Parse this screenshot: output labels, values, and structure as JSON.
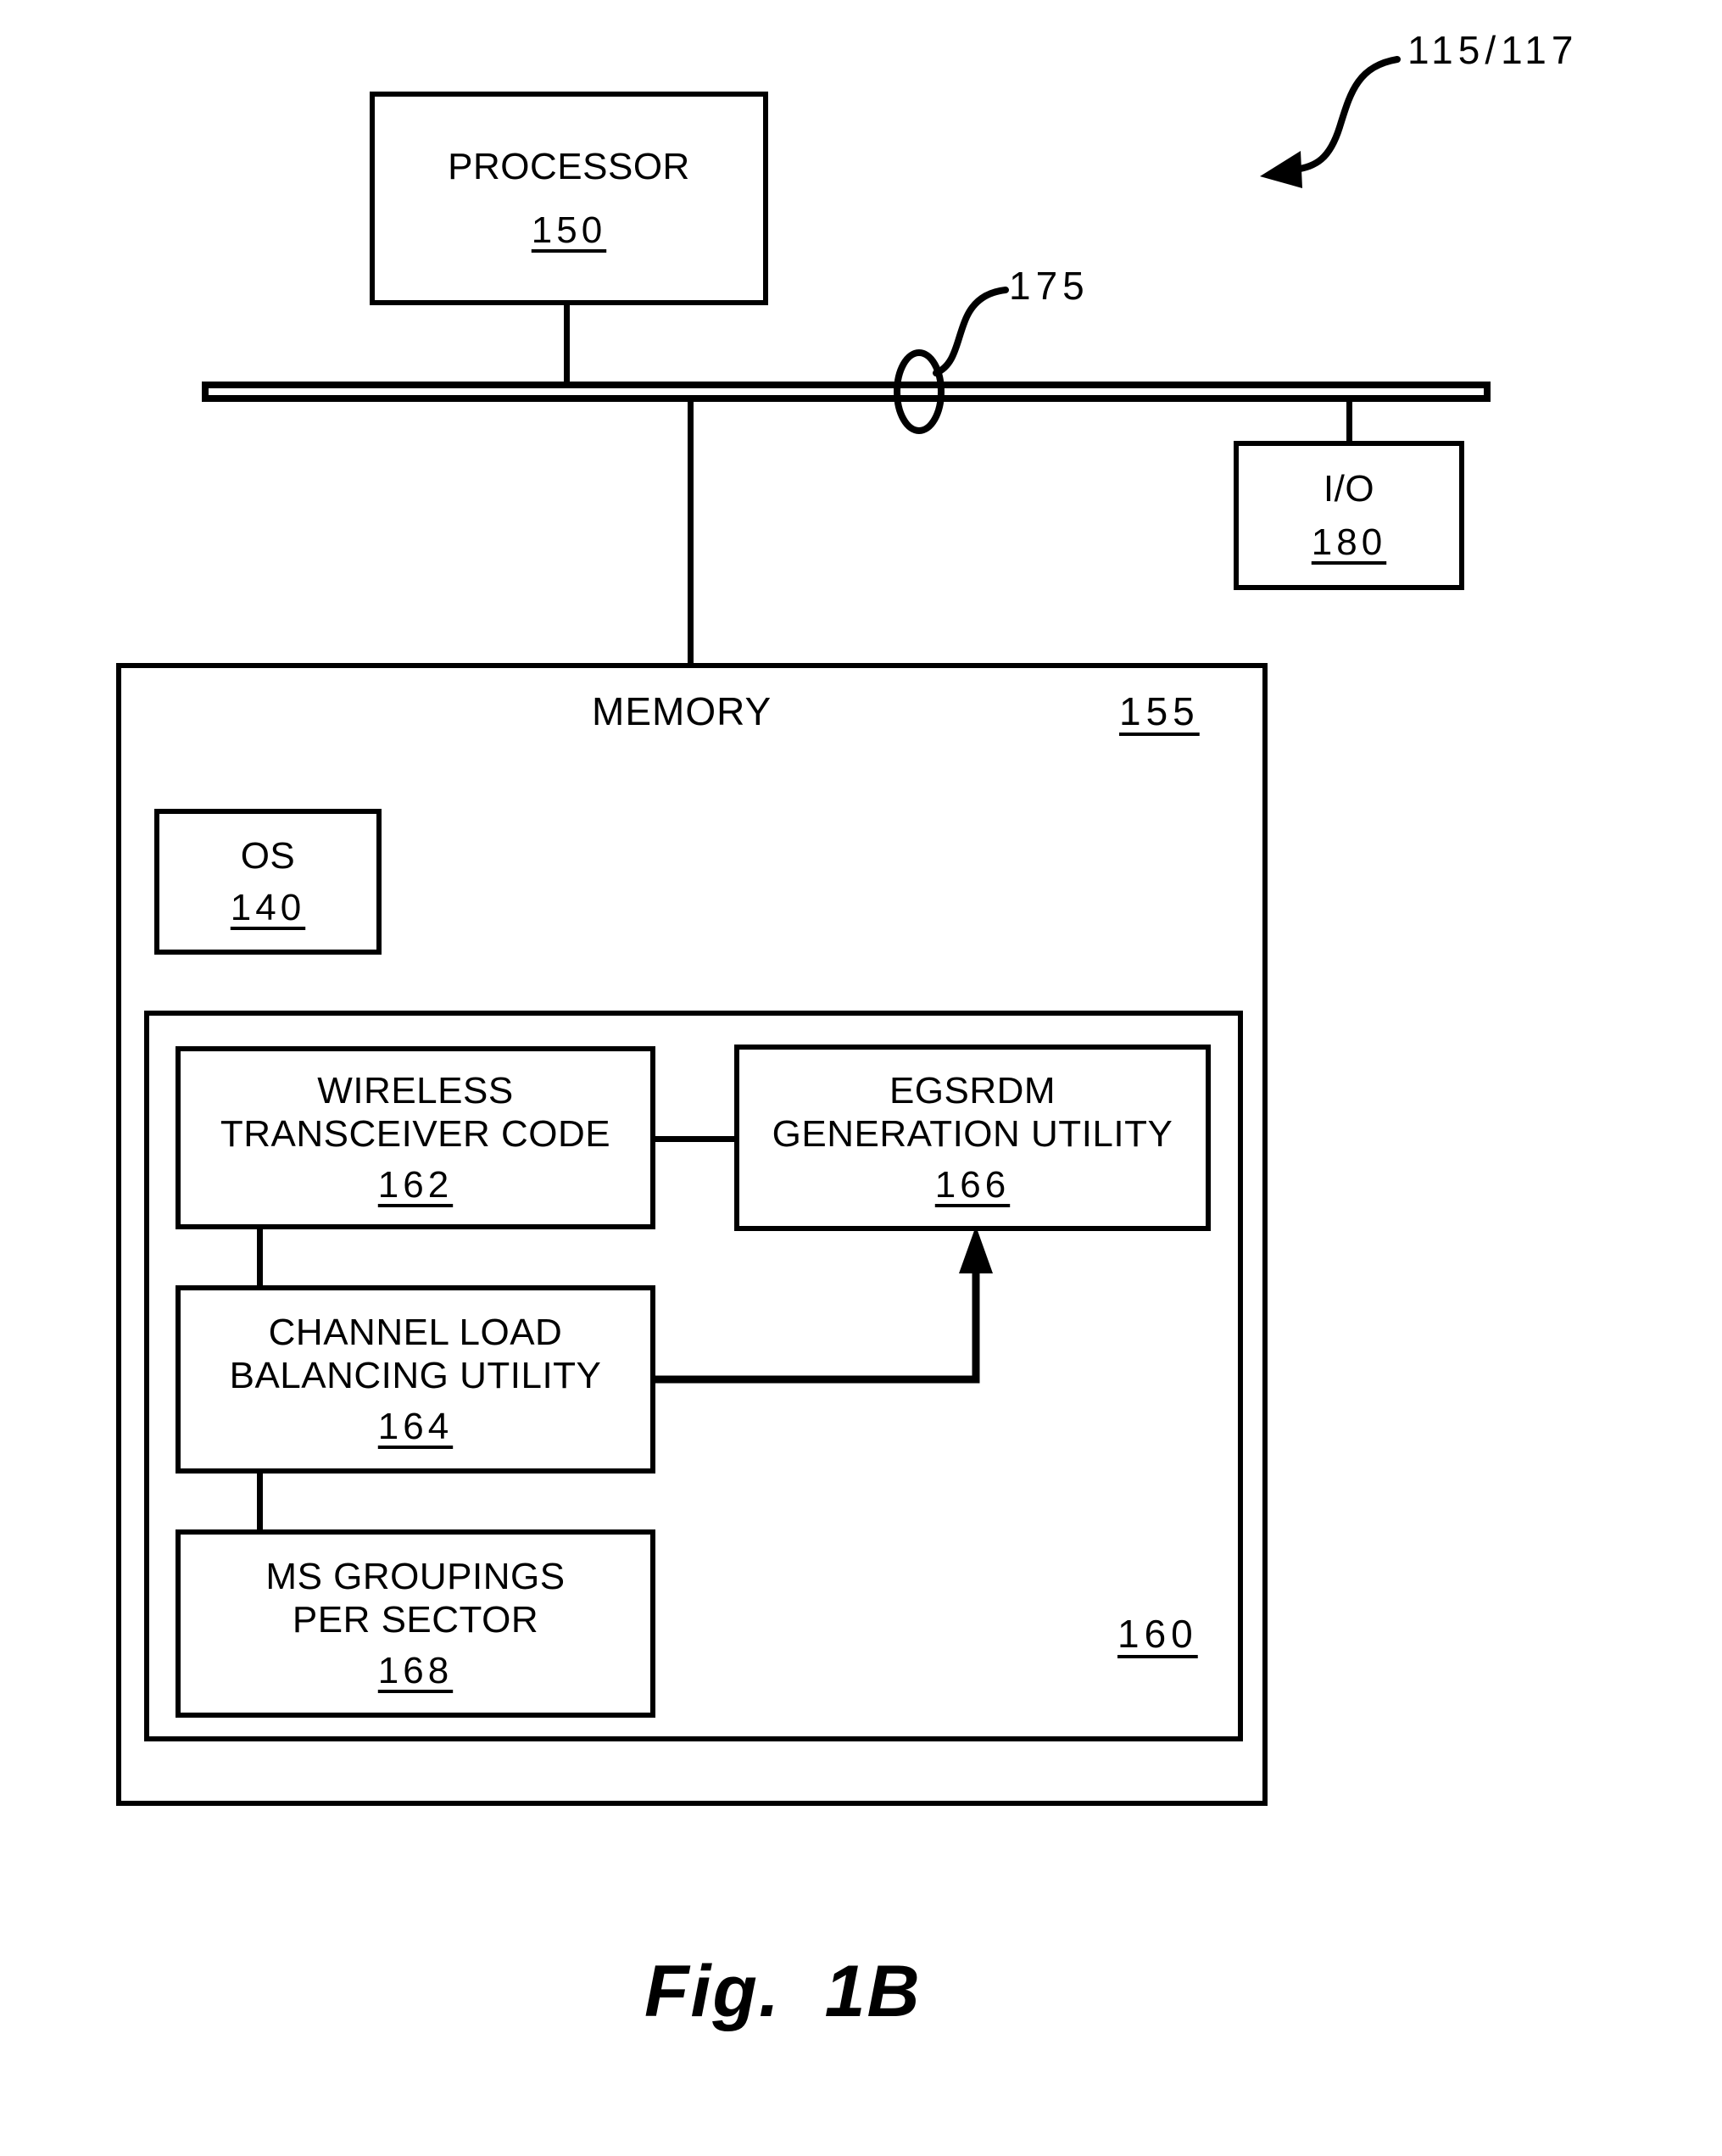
{
  "figure": {
    "caption": "Fig.  1B",
    "top_reference": "115/117",
    "bus_reference": "175"
  },
  "blocks": {
    "processor": {
      "title": "PROCESSOR",
      "ref": "150"
    },
    "io": {
      "title": "I/O",
      "ref": "180"
    },
    "memory": {
      "title": "MEMORY",
      "ref": "155"
    },
    "os": {
      "title": "OS",
      "ref": "140"
    },
    "software_container": {
      "ref": "160"
    },
    "wireless_transceiver_code": {
      "title": "WIRELESS\nTRANSCEIVER CODE",
      "ref": "162"
    },
    "egsrdm_generation_utility": {
      "title": "EGSRDM\nGENERATION UTILITY",
      "ref": "166"
    },
    "channel_load_balancing_utility": {
      "title": "CHANNEL LOAD\nBALANCING UTILITY",
      "ref": "164"
    },
    "ms_groupings_per_sector": {
      "title": "MS GROUPINGS\nPER SECTOR",
      "ref": "168"
    }
  },
  "colors": {
    "stroke": "#000000",
    "background": "#ffffff"
  }
}
